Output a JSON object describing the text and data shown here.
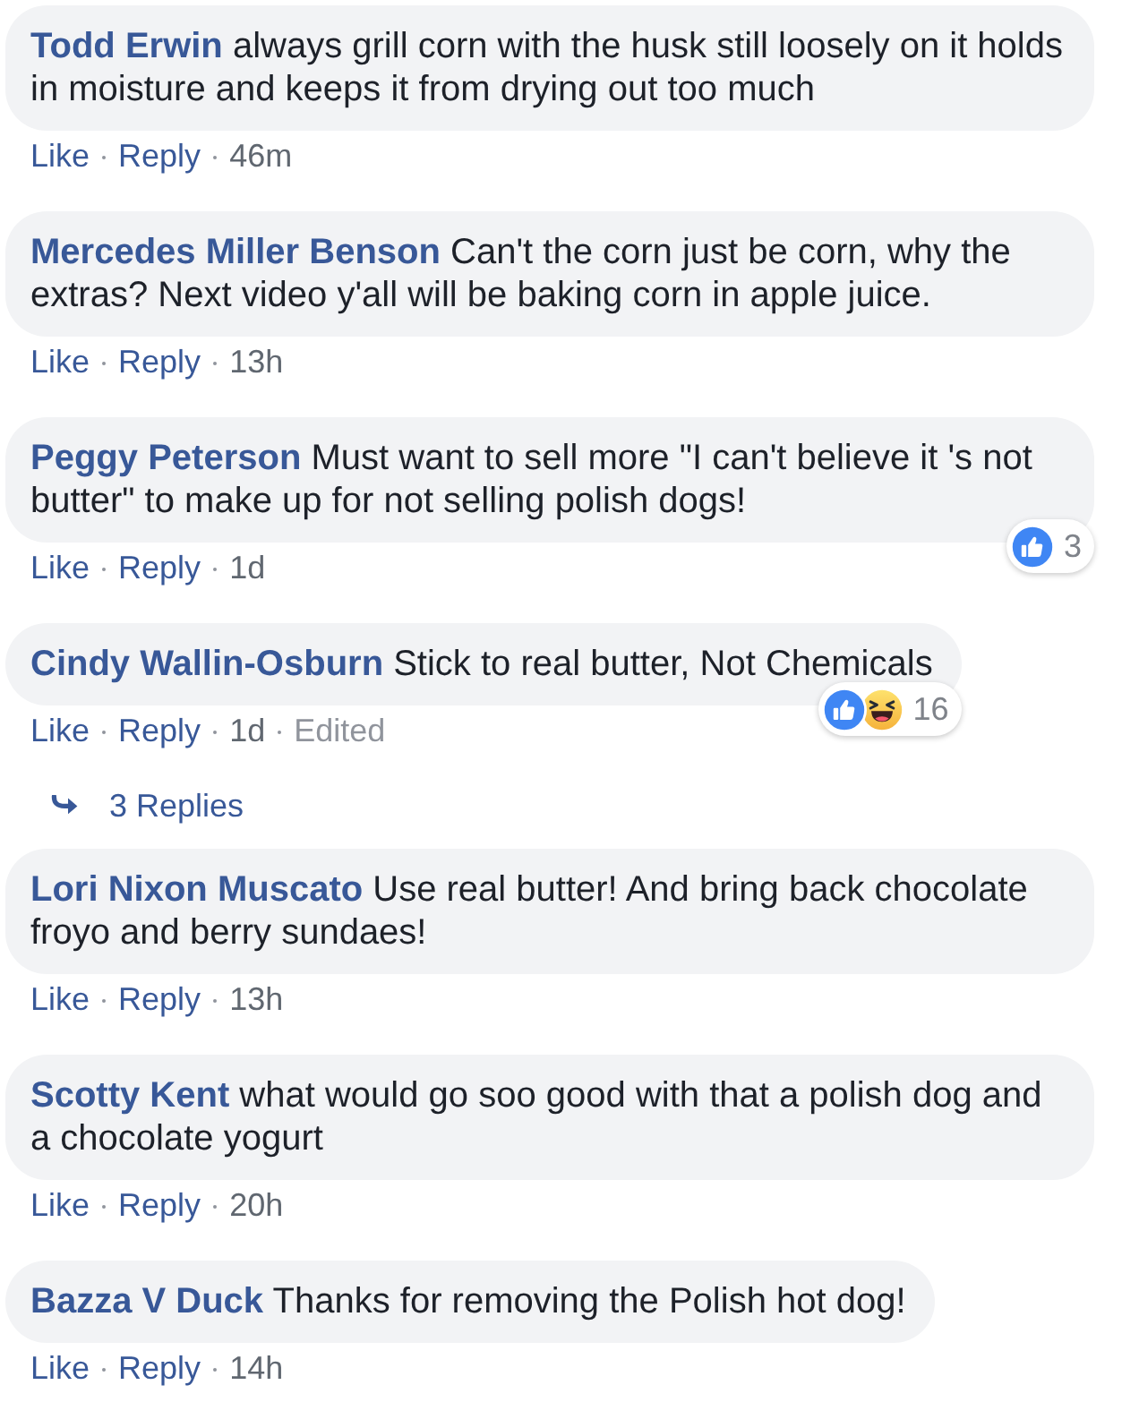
{
  "comments": [
    {
      "author": "Todd Erwin",
      "text": "always grill corn with the husk still loosely on it holds in moisture and keeps it from drying out too much",
      "actions": [
        "Like",
        "Reply"
      ],
      "time": "46m"
    },
    {
      "author": "Mercedes Miller Benson",
      "text": "Can't the corn just be corn, why the extras? Next video y'all will be baking corn in apple juice.",
      "actions": [
        "Like",
        "Reply"
      ],
      "time": "13h"
    },
    {
      "author": "Peggy Peterson",
      "text": "Must want to sell more \"I can't believe it 's not butter\" to make up for not selling polish dogs!",
      "actions": [
        "Like",
        "Reply"
      ],
      "time": "1d",
      "reactions": {
        "icons": [
          {
            "kind": "like"
          }
        ],
        "count": "3"
      }
    },
    {
      "author": "Cindy Wallin-Osburn",
      "text": "Stick to real butter, Not Chemicals",
      "actions": [
        "Like",
        "Reply"
      ],
      "time": "1d",
      "edited_label": "Edited",
      "reactions": {
        "icons": [
          {
            "kind": "like"
          },
          {
            "kind": "haha"
          }
        ],
        "count": "16"
      },
      "replies_link": "3 Replies"
    },
    {
      "author": "Lori Nixon Muscato",
      "text": "Use real butter! And bring back chocolate froyo and berry sundaes!",
      "actions": [
        "Like",
        "Reply"
      ],
      "time": "13h"
    },
    {
      "author": "Scotty Kent",
      "text": "what would go soo good with that a polish dog and a chocolate yogurt",
      "actions": [
        "Like",
        "Reply"
      ],
      "time": "20h"
    },
    {
      "author": "Bazza V Duck",
      "text": "Thanks for removing the Polish hot dog!",
      "actions": [
        "Like",
        "Reply"
      ],
      "time": "14h"
    }
  ]
}
